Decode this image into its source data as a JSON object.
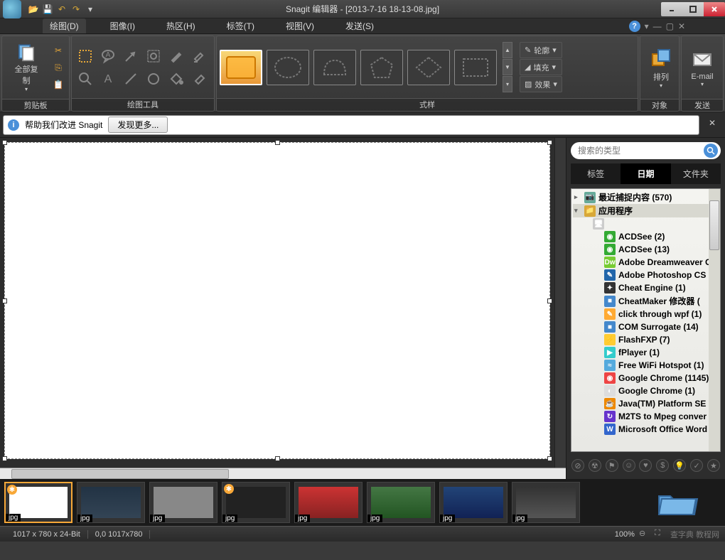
{
  "title": "Snagit 编辑器 - [2013-7-16 18-13-08.jpg]",
  "menubar": {
    "items": [
      {
        "label": "绘图(D)",
        "active": true
      },
      {
        "label": "图像(I)"
      },
      {
        "label": "热区(H)"
      },
      {
        "label": "标签(T)"
      },
      {
        "label": "视图(V)"
      },
      {
        "label": "发送(S)"
      }
    ]
  },
  "ribbon": {
    "clipboard": {
      "label": "剪贴板",
      "copyAll": "全部复制"
    },
    "tools": {
      "label": "绘图工具"
    },
    "styles": {
      "label": "式样",
      "outline": "轮廓",
      "fill": "填充",
      "effect": "效果"
    },
    "object": {
      "label": "对象",
      "arrange": "排列"
    },
    "send": {
      "label": "发送",
      "email": "E-mail"
    }
  },
  "info": {
    "help": "帮助我们改进 Snagit",
    "discover": "发现更多..."
  },
  "search": {
    "placeholder": "搜索的类型"
  },
  "panelTabs": [
    {
      "label": "标签"
    },
    {
      "label": "日期",
      "active": true
    },
    {
      "label": "文件夹"
    }
  ],
  "tree": [
    {
      "label": "最近捕捉内容 (570)",
      "depth": 0,
      "icon": "📷",
      "bg": "#6a9"
    },
    {
      "label": "应用程序",
      "depth": 0,
      "icon": "📁",
      "bg": "#d8a838",
      "sel": true,
      "open": true
    },
    {
      "label": "",
      "depth": 1,
      "icon": "🖥",
      "bg": "#ccc"
    },
    {
      "label": "ACDSee (2)",
      "depth": 2,
      "icon": "◉",
      "bg": "#3a3"
    },
    {
      "label": "ACDSee (13)",
      "depth": 2,
      "icon": "◉",
      "bg": "#3a3"
    },
    {
      "label": "Adobe Dreamweaver C",
      "depth": 2,
      "icon": "Dw",
      "bg": "#7c3"
    },
    {
      "label": "Adobe Photoshop CS",
      "depth": 2,
      "icon": "✎",
      "bg": "#26a"
    },
    {
      "label": "Cheat Engine (1)",
      "depth": 2,
      "icon": "✦",
      "bg": "#333"
    },
    {
      "label": "CheatMaker 修改器 (",
      "depth": 2,
      "icon": "■",
      "bg": "#48c"
    },
    {
      "label": "click through wpf (1)",
      "depth": 2,
      "icon": "✎",
      "bg": "#fa3"
    },
    {
      "label": "COM Surrogate (14)",
      "depth": 2,
      "icon": "■",
      "bg": "#48c"
    },
    {
      "label": "FlashFXP (7)",
      "depth": 2,
      "icon": "⚡",
      "bg": "#fc3"
    },
    {
      "label": "fPlayer (1)",
      "depth": 2,
      "icon": "▶",
      "bg": "#3cc"
    },
    {
      "label": "Free WiFi Hotspot (1)",
      "depth": 2,
      "icon": "≈",
      "bg": "#5ad"
    },
    {
      "label": "Google Chrome (1145)",
      "depth": 2,
      "icon": "◉",
      "bg": "#e44"
    },
    {
      "label": "Google Chrome (1)",
      "depth": 2,
      "icon": "◐",
      "bg": "#ddd"
    },
    {
      "label": "Java(TM) Platform SE",
      "depth": 2,
      "icon": "☕",
      "bg": "#e80"
    },
    {
      "label": "M2TS to Mpeg conver",
      "depth": 2,
      "icon": "↻",
      "bg": "#63c"
    },
    {
      "label": "Microsoft Office Word",
      "depth": 2,
      "icon": "W",
      "bg": "#36c"
    }
  ],
  "thumbs": [
    {
      "ext": "jpg",
      "badge": true,
      "sel": true,
      "bg": "#fff"
    },
    {
      "ext": "jpg",
      "bg": "linear-gradient(#234,#345)"
    },
    {
      "ext": "jpg",
      "bg": "#888"
    },
    {
      "ext": "jpg",
      "badge": true,
      "bg": "#222"
    },
    {
      "ext": "jpg",
      "bg": "linear-gradient(#c33,#822)"
    },
    {
      "ext": "jpg",
      "bg": "linear-gradient(#474,#252)"
    },
    {
      "ext": "jpg",
      "bg": "linear-gradient(#247,#125)"
    },
    {
      "ext": "jpg",
      "bg": "linear-gradient(#333,#555)"
    }
  ],
  "status": {
    "dims": "1017 x 780 x 24-Bit",
    "pos": "0,0  1017x780",
    "zoom": "100%"
  },
  "watermark": "查字典 教程网"
}
